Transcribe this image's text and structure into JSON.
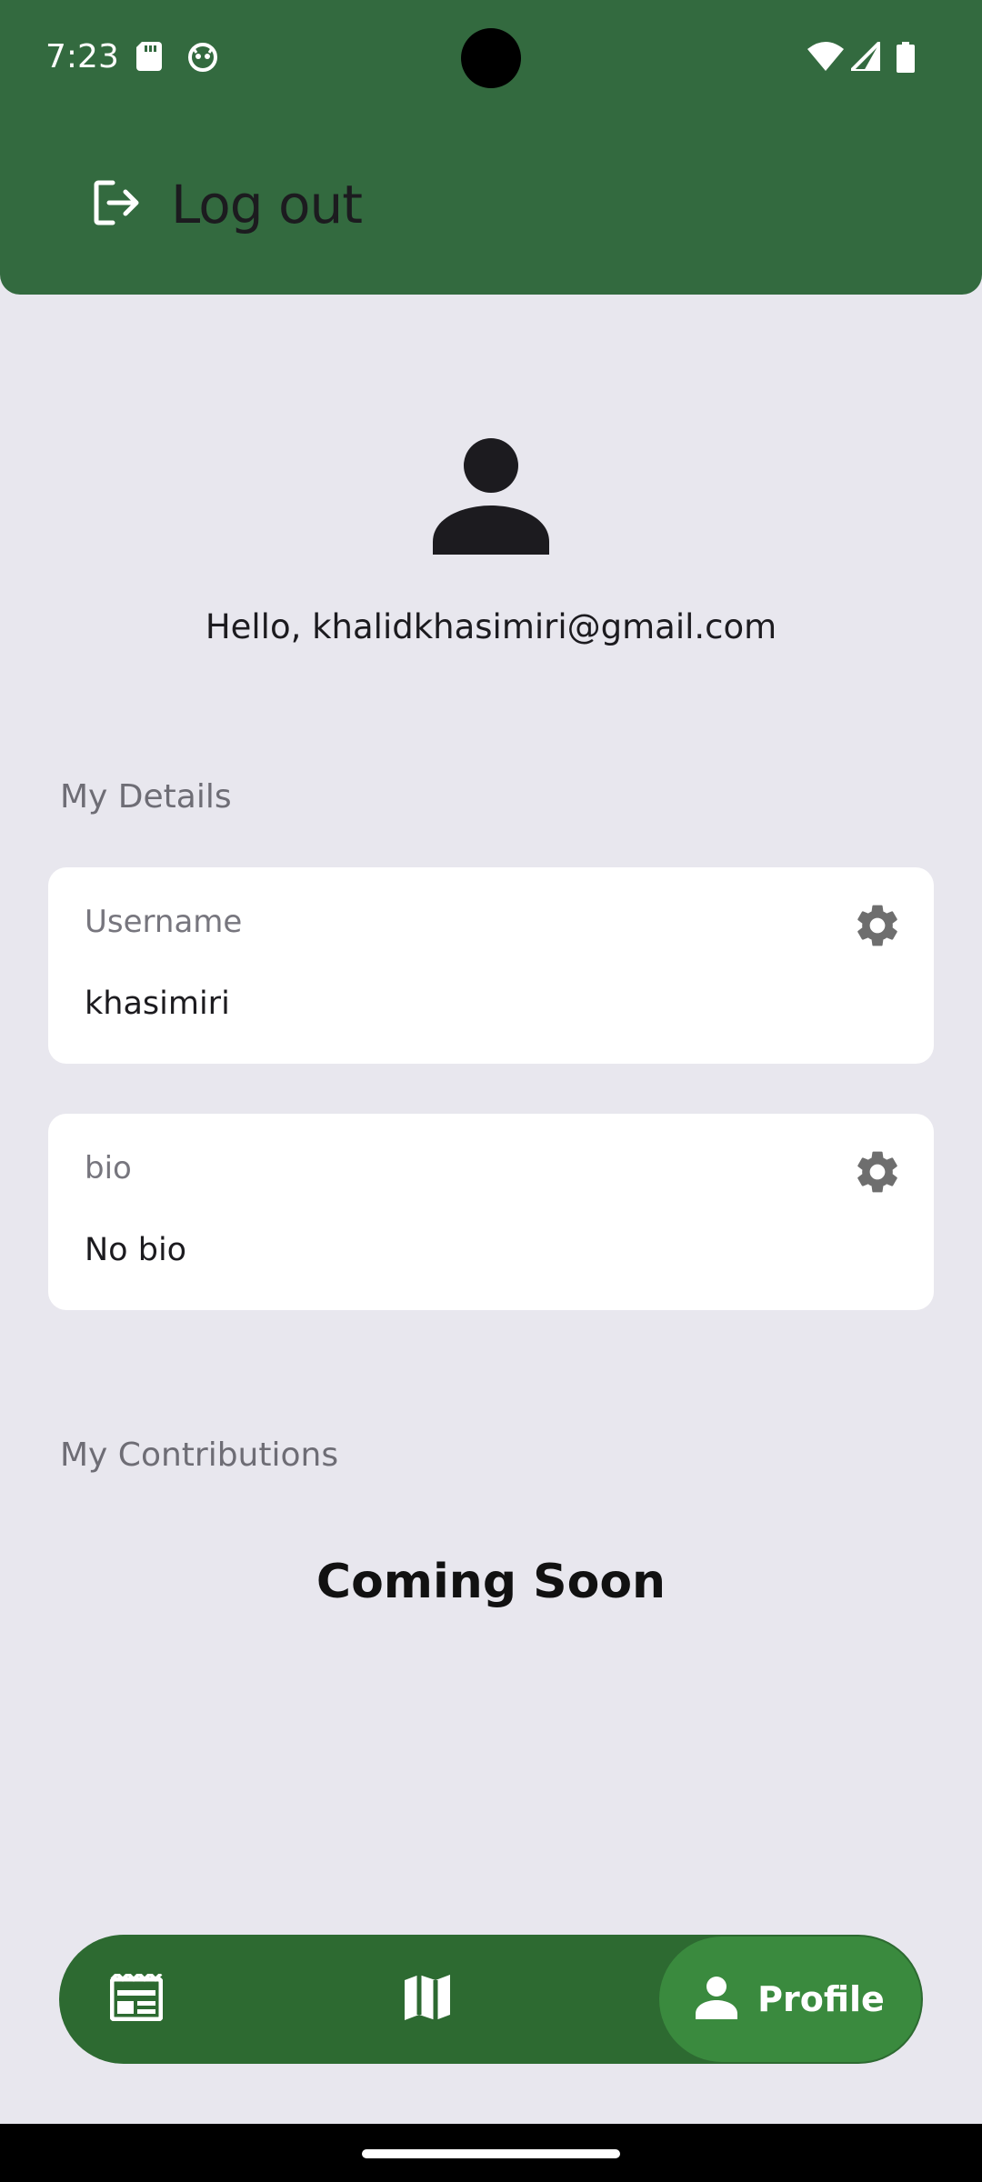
{
  "status_bar": {
    "time": "7:23",
    "left_icons": [
      "sd-card-icon",
      "cat-face-icon"
    ],
    "right_icons": [
      "wifi-icon",
      "signal-icon",
      "battery-icon"
    ]
  },
  "header": {
    "logout_label": "Log out",
    "logout_icon": "logout-icon",
    "background_color": "#336a3f"
  },
  "profile": {
    "avatar_icon": "person-icon",
    "greeting": "Hello, khalidkhasimiri@gmail.com"
  },
  "details": {
    "section_title": "My Details",
    "cards": [
      {
        "label": "Username",
        "value": "khasimiri",
        "action_icon": "gear-icon"
      },
      {
        "label": "bio",
        "value": "No bio",
        "action_icon": "gear-icon"
      }
    ]
  },
  "contributions": {
    "section_title": "My Contributions",
    "message": "Coming Soon"
  },
  "bottom_nav": {
    "items": [
      {
        "icon": "feed-icon",
        "label": ""
      },
      {
        "icon": "map-icon",
        "label": ""
      },
      {
        "icon": "person-icon",
        "label": "Profile",
        "active": true
      }
    ],
    "background_color": "#2d6a31",
    "active_color": "#3a8a3e"
  }
}
